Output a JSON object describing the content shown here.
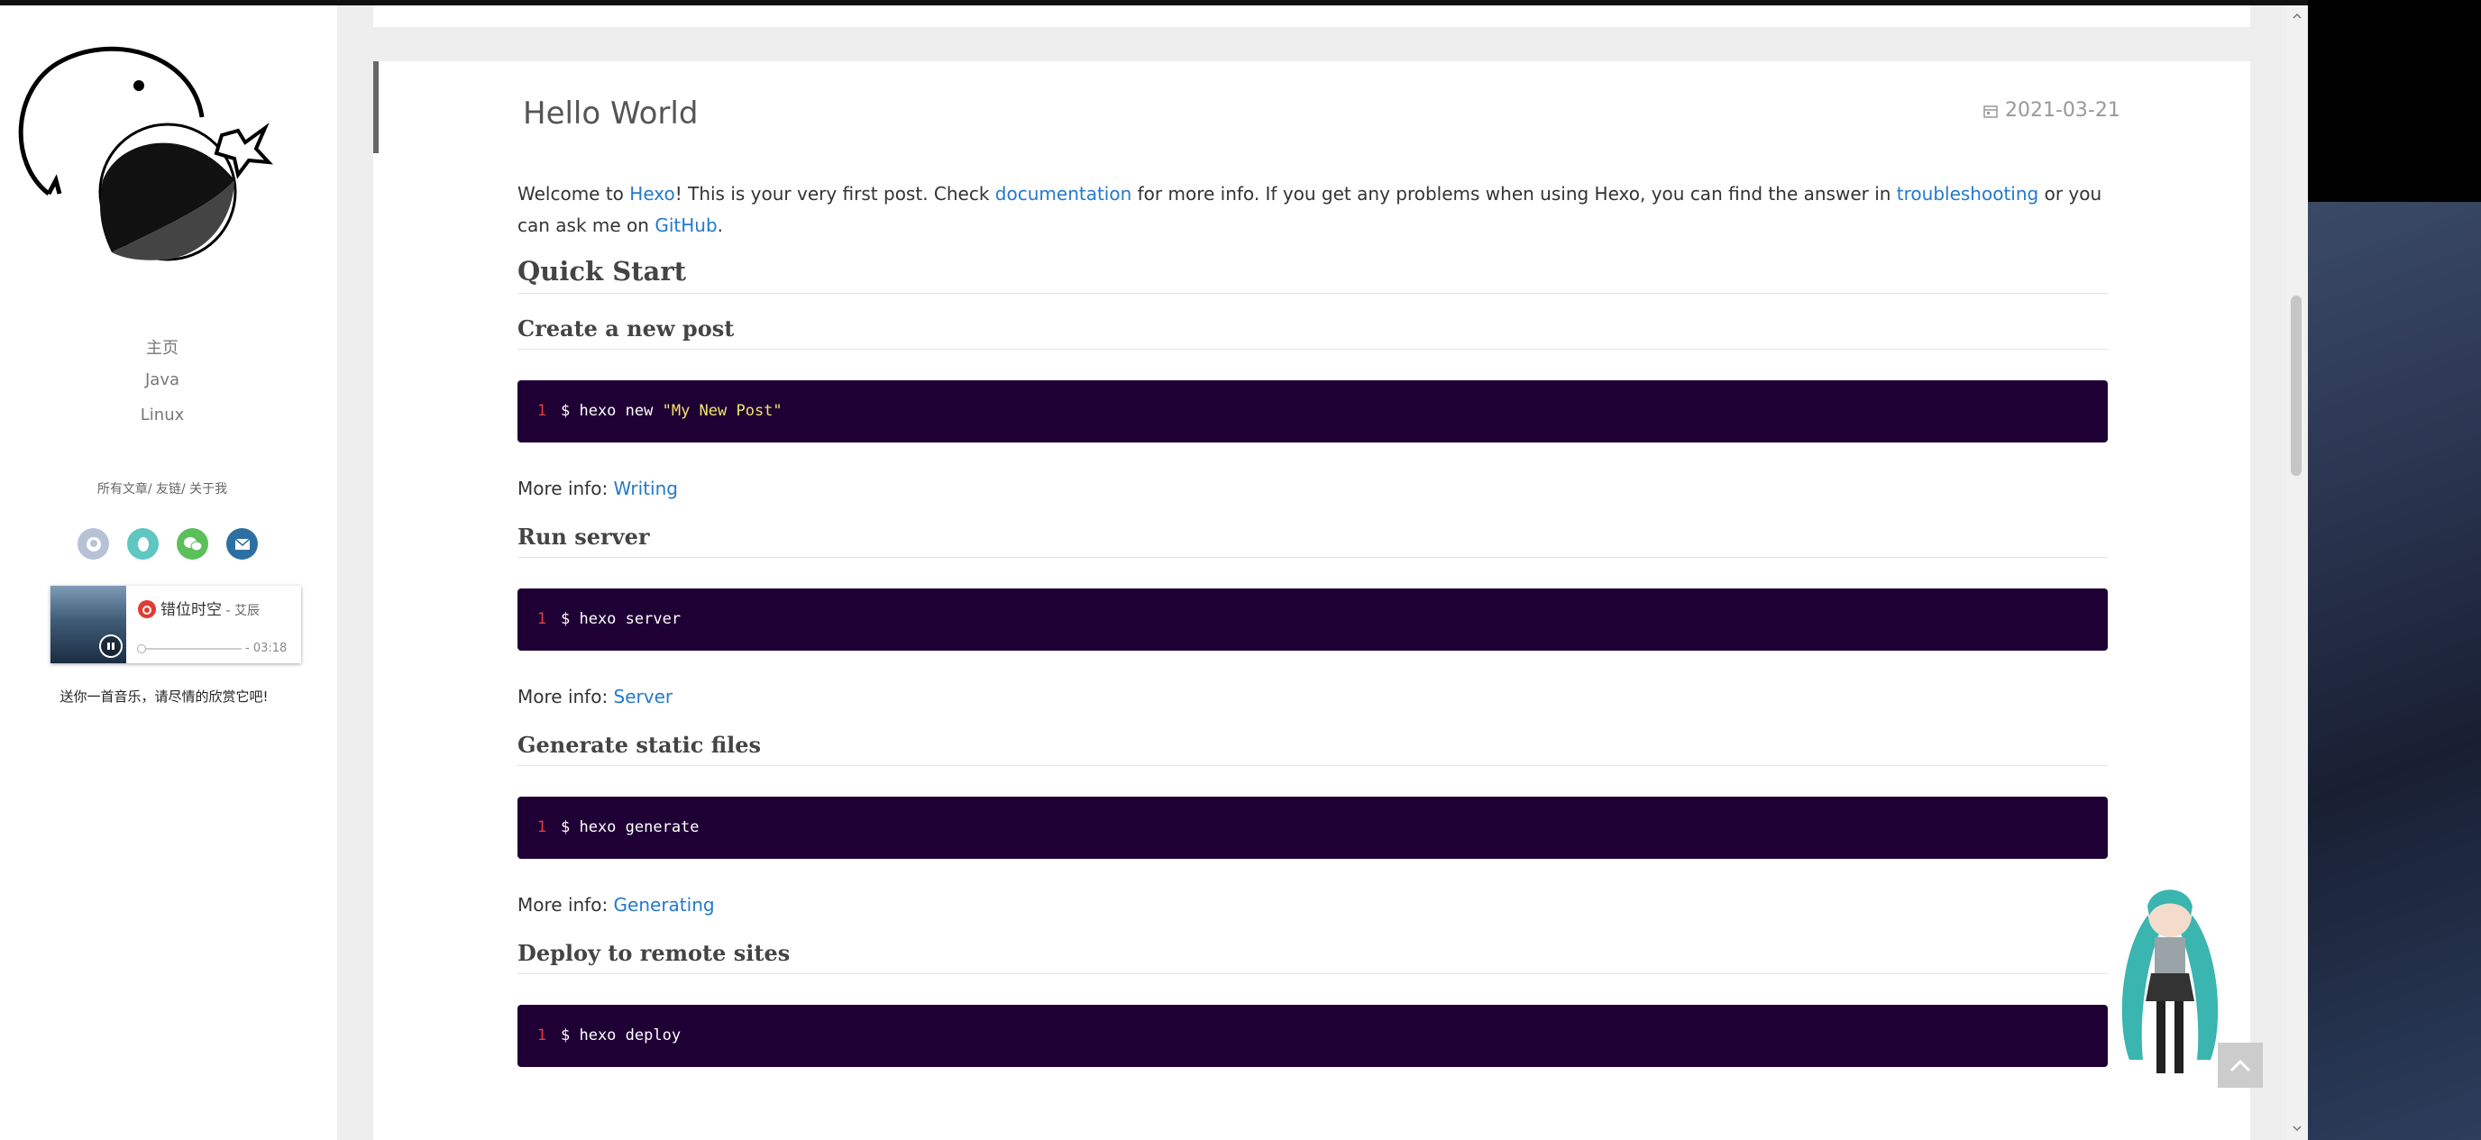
{
  "sidebar": {
    "nav": [
      {
        "label": "主页"
      },
      {
        "label": "Java"
      },
      {
        "label": "Linux"
      }
    ],
    "meta_links": [
      "所有文章",
      "友链",
      "关于我"
    ],
    "socials": [
      {
        "name": "github-icon",
        "color": "#b7c2d6"
      },
      {
        "name": "qq-icon",
        "color": "#5fc6c1"
      },
      {
        "name": "wechat-icon",
        "color": "#5bbf5b"
      },
      {
        "name": "email-icon",
        "color": "#2e6fa3"
      }
    ],
    "player": {
      "song": "错位时空",
      "artist": " - 艾辰",
      "time": "- 03:18",
      "progress": 0.0
    },
    "music_note": "送你一首音乐，请尽情的欣赏它吧!"
  },
  "post": {
    "title": "Hello World",
    "date": "2021-03-21",
    "intro": {
      "t1": "Welcome to ",
      "l1": "Hexo",
      "t2": "! This is your very first post. Check ",
      "l2": "documentation",
      "t3": " for more info. If you get any problems when using Hexo, you can find the answer in ",
      "l3": "troubleshooting",
      "t4": " or you can ask me on ",
      "l4": "GitHub",
      "t5": "."
    },
    "quick_start": "Quick Start",
    "sections": [
      {
        "heading": "Create a new post",
        "line_no": "1",
        "cmd": "$ hexo new ",
        "cmd_str": "\"My New Post\"",
        "more_prefix": "More info: ",
        "more_link": "Writing"
      },
      {
        "heading": "Run server",
        "line_no": "1",
        "cmd": "$ hexo server",
        "cmd_str": "",
        "more_prefix": "More info: ",
        "more_link": "Server"
      },
      {
        "heading": "Generate static files",
        "line_no": "1",
        "cmd": "$ hexo generate",
        "cmd_str": "",
        "more_prefix": "More info: ",
        "more_link": "Generating"
      },
      {
        "heading": "Deploy to remote sites",
        "line_no": "1",
        "cmd": "$ hexo deploy",
        "cmd_str": "",
        "more_prefix": "",
        "more_link": ""
      }
    ]
  },
  "colors": {
    "link": "#2479cc",
    "code_bg": "#1e0034",
    "code_string": "#f5e36b",
    "line_number": "#e04040"
  }
}
